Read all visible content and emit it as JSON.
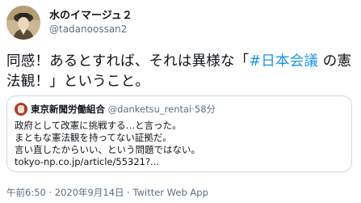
{
  "author": {
    "display_name": "水のイマージュ２",
    "handle": "@tadanoossan2",
    "avatar_icon": "profile-photo-icon"
  },
  "tweet": {
    "line1_before": "同感！あるとすれば、それは異様な「",
    "hashtag": "#日本会議",
    "line1_after": " の憲",
    "line2": "法観！」ということ。"
  },
  "quote": {
    "display_name": "東京新聞労働組合",
    "handle": "@danketsu_rentai",
    "separator": "·",
    "time": "58分",
    "lines": [
      "政府として改憲に挑戦する…と言った。",
      "まともな憲法観を持ってない証拠だ。",
      "言い直したからいい、という問題ではない。",
      "tokyo-np.co.jp/article/55321?..."
    ]
  },
  "meta": {
    "timestamp": "午前6:50 · 2020年9月14日",
    "separator": " · ",
    "source": "Twitter Web App"
  },
  "colors": {
    "hashtag": "#1b95e0",
    "secondary_text": "#5b7083",
    "border": "#cfd9de"
  }
}
